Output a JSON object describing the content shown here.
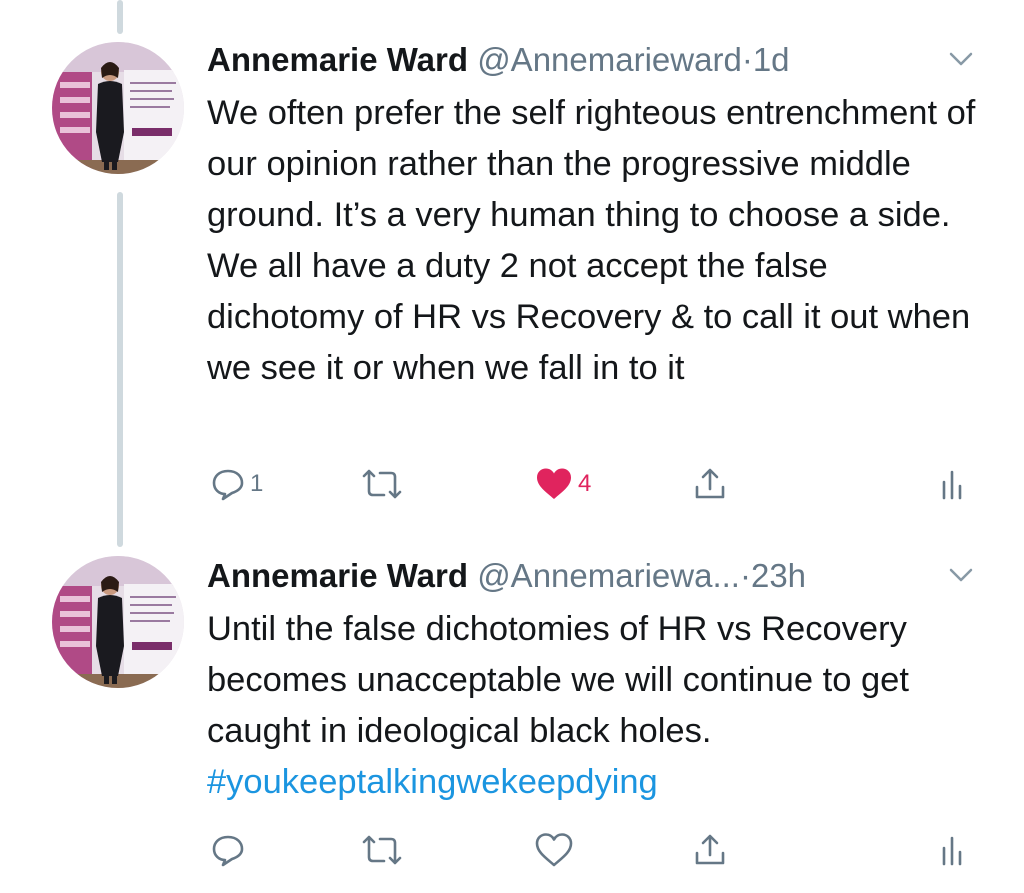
{
  "tweets": [
    {
      "author": "Annemarie Ward",
      "handle": "@Annemarieward",
      "separator": "·",
      "time": "1d",
      "text": "We often prefer the self righteous entrenchment of our opinion rather than the progressive middle ground. It’s a very human thing to choose a side. We all have a duty 2 not accept the false dichotomy of HR vs Recovery & to call it out when we see it or when we fall in to it",
      "hashtag": "",
      "reply_count": "1",
      "retweet_count": "",
      "like_count": "4",
      "liked": true
    },
    {
      "author": "Annemarie Ward",
      "handle": "@Annemariewa...",
      "separator": "·",
      "time": "23h",
      "text": "Until the false dichotomies of HR vs Recovery becomes unacceptable we will continue to get caught in ideological black holes. ",
      "hashtag": "#youkeeptalkingwekeepdying",
      "reply_count": "",
      "retweet_count": "",
      "like_count": "",
      "liked": false
    }
  ],
  "icons": {
    "reply": "reply-icon",
    "retweet": "retweet-icon",
    "like": "heart-icon",
    "share": "share-icon",
    "analytics": "analytics-icon",
    "more": "chevron-down-icon"
  },
  "colors": {
    "text": "#14171a",
    "secondary": "#657786",
    "like": "#e0245e",
    "link": "#1b95e0",
    "thread_line": "#cfd9de"
  }
}
